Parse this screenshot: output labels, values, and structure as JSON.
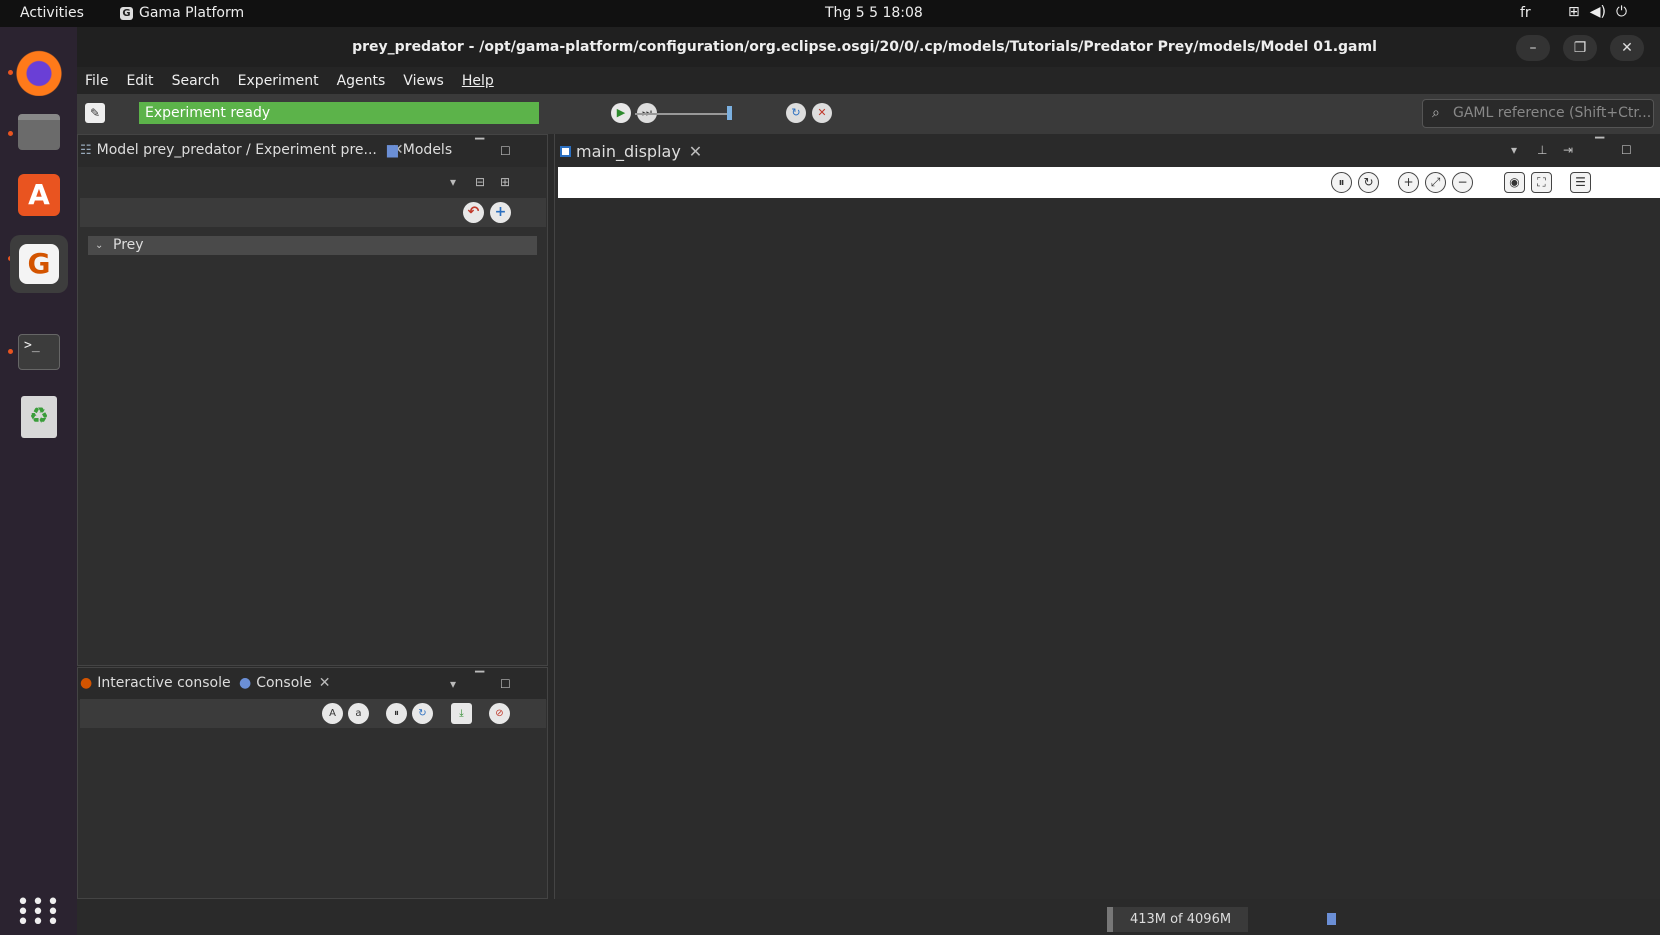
{
  "topbar": {
    "activities": "Activities",
    "app_name": "Gama Platform",
    "clock": "Thg 5 5  18:08",
    "language": "fr"
  },
  "window": {
    "title": "prey_predator - /opt/gama-platform/configuration/org.eclipse.osgi/20/0/.cp/models/Tutorials/Predator Prey/models/Model 01.gaml"
  },
  "menu": [
    "File",
    "Edit",
    "Search",
    "Experiment",
    "Agents",
    "Views",
    "Help"
  ],
  "toolbar": {
    "status": "Experiment ready",
    "status_color": "#5cb34a",
    "search_placeholder": "GAML reference (Shift+Ctr..."
  },
  "left_panel": {
    "tab_model": "Model prey_predator / Experiment pre...",
    "tab_models": "Models",
    "tree_item": "Prey"
  },
  "console_panel": {
    "tab_interactive": "Interactive console",
    "tab_console": "Console"
  },
  "display_panel": {
    "tab": "main_display"
  },
  "status": {
    "memory": "413M of 4096M"
  }
}
